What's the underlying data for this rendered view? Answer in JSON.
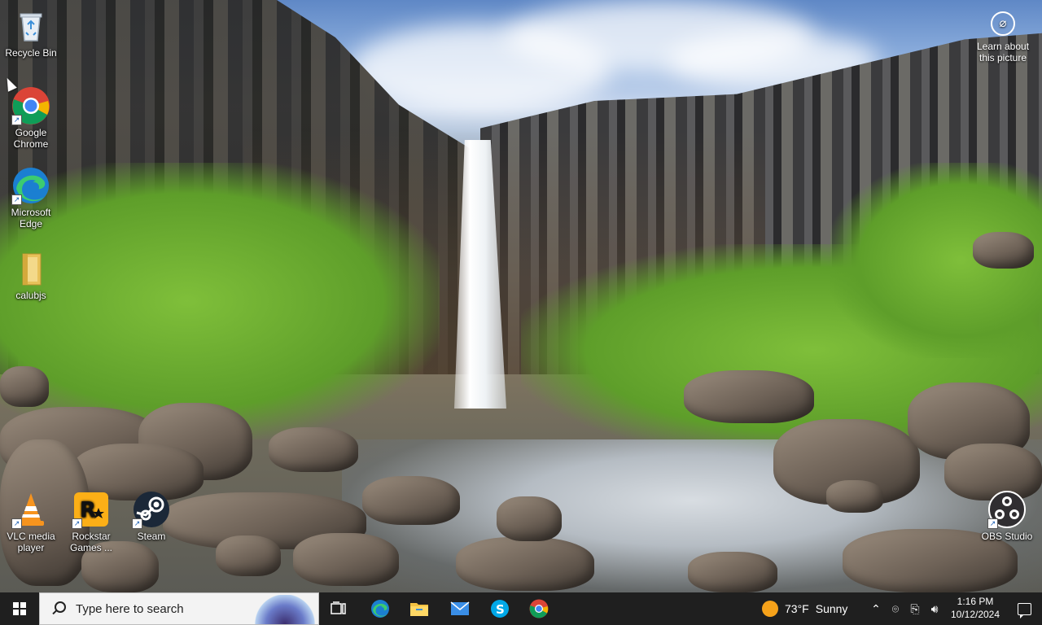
{
  "desktop": {
    "icons": [
      {
        "label": "Recycle Bin"
      },
      {
        "label": "Google Chrome"
      },
      {
        "label": "Microsoft Edge"
      },
      {
        "label": "calubjs"
      },
      {
        "label": "VLC media player"
      },
      {
        "label": "Rockstar Games ..."
      },
      {
        "label": "Steam"
      },
      {
        "label": "OBS Studio"
      }
    ],
    "learn_more": {
      "label": "Learn about this picture"
    }
  },
  "taskbar": {
    "search_placeholder": "Type here to search",
    "apps": [
      {
        "name": "task-view-icon"
      },
      {
        "name": "edge-icon"
      },
      {
        "name": "file-explorer-icon"
      },
      {
        "name": "mail-icon"
      },
      {
        "name": "skype-icon"
      },
      {
        "name": "chrome-icon"
      }
    ],
    "weather": {
      "temp": "73°F",
      "condition": "Sunny"
    },
    "clock": {
      "time": "1:16 PM",
      "date": "10/12/2024"
    }
  },
  "colors": {
    "taskbar_bg": "#1f1f1f",
    "search_bg": "#f3f3f3",
    "weather_sun": "#f6a21a",
    "active_indicator": "#8ab4f8"
  }
}
